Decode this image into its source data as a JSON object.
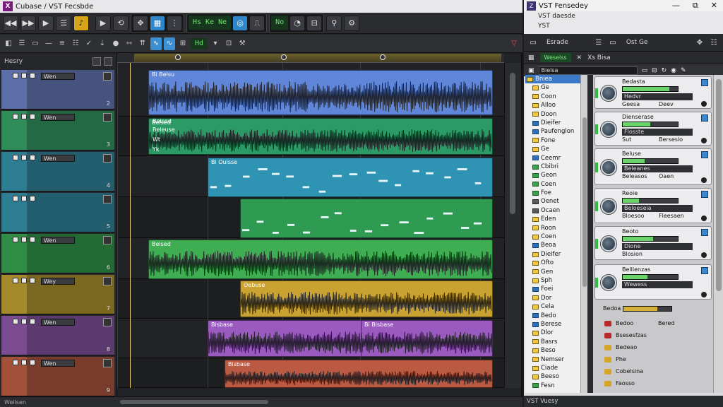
{
  "daw": {
    "title": "Cubase / VST Fecsbde",
    "logo": "X",
    "lcd_left": "Hs Ke Ne",
    "lcd_right": "No",
    "inspector_title": "Hesry",
    "status": "Weilsen",
    "tracks": [
      {
        "name": "Wen",
        "color": "#5c6fa8",
        "index": "2"
      },
      {
        "name": "Wen",
        "color": "#2f8d5a",
        "index": "3"
      },
      {
        "name": "Wen",
        "color": "#2d7d93",
        "index": "4"
      },
      {
        "name": "",
        "color": "#2d7d93",
        "index": "5"
      },
      {
        "name": "Wen",
        "color": "#2f8d45",
        "index": "6"
      },
      {
        "name": "Wey",
        "color": "#a48a2a",
        "index": "7"
      },
      {
        "name": "Wen",
        "color": "#7b4c92",
        "index": "8"
      },
      {
        "name": "Wen",
        "color": "#a3503a",
        "index": "9"
      }
    ],
    "clips": [
      {
        "name": "Bi Belsu",
        "color": "#5f86d8"
      },
      {
        "name": "Belsed",
        "color": "#2b9a64"
      },
      {
        "name": "Bi Ouisse",
        "color": "#2f93b3"
      },
      {
        "name": "",
        "color": "#2f9a52"
      },
      {
        "name": "Belsed",
        "color": "#3fae52"
      },
      {
        "name": "Oebuse",
        "color": "#c9a231"
      },
      {
        "name": "Bisbase",
        "color": "#9a5ac0"
      },
      {
        "name": "Bi Bisbase",
        "color": "#9a5ac0"
      },
      {
        "name": "Bisbase",
        "color": "#bb5a42"
      }
    ],
    "sub_labels": [
      "Belsed",
      "Beleuse",
      "Wt",
      "Yk"
    ]
  },
  "vst": {
    "title": "VST Fensedey",
    "logo": "Z",
    "sub1": "VST daesde",
    "sub2": "YST",
    "tab1": "Esrade",
    "tab2": "Ost Ge",
    "chip1": "Weselss",
    "chip2": "Xs Bisa",
    "search_label": "Bielsa",
    "status": "VST Vuesy",
    "tree": [
      {
        "label": "Bniea",
        "type": "sel"
      },
      {
        "label": "Ge",
        "type": "yellow"
      },
      {
        "label": "Coon",
        "type": "yellow"
      },
      {
        "label": "Alloo",
        "type": "yellow"
      },
      {
        "label": "Doon",
        "type": "yellow"
      },
      {
        "label": "Dieifer",
        "type": "blue"
      },
      {
        "label": "Paufenglon",
        "type": "blue"
      },
      {
        "label": "Fone",
        "type": "yellow"
      },
      {
        "label": "Ge",
        "type": "yellow"
      },
      {
        "label": "Ceemr",
        "type": "blue"
      },
      {
        "label": "Cbibri",
        "type": "green"
      },
      {
        "label": "Geon",
        "type": "green"
      },
      {
        "label": "Coen",
        "type": "green"
      },
      {
        "label": "Foe",
        "type": "green"
      },
      {
        "label": "Oenet",
        "type": "dark"
      },
      {
        "label": "Ocaen",
        "type": "dark"
      },
      {
        "label": "Eden",
        "type": "yellow"
      },
      {
        "label": "Roon",
        "type": "yellow"
      },
      {
        "label": "Coen",
        "type": "yellow"
      },
      {
        "label": "Beoa",
        "type": "blue"
      },
      {
        "label": "Dieifer",
        "type": "yellow"
      },
      {
        "label": "Ofto",
        "type": "yellow"
      },
      {
        "label": "Gen",
        "type": "yellow"
      },
      {
        "label": "Sph",
        "type": "yellow"
      },
      {
        "label": "Foei",
        "type": "blue"
      },
      {
        "label": "Dor",
        "type": "yellow"
      },
      {
        "label": "Cela",
        "type": "yellow"
      },
      {
        "label": "Bedo",
        "type": "blue"
      },
      {
        "label": "Berese",
        "type": "blue"
      },
      {
        "label": "Dlor",
        "type": "yellow"
      },
      {
        "label": "Basrs",
        "type": "yellow"
      },
      {
        "label": "Beso",
        "type": "yellow"
      },
      {
        "label": "Nemser",
        "type": "yellow"
      },
      {
        "label": "Ciade",
        "type": "yellow"
      },
      {
        "label": "Beeso",
        "type": "yellow"
      },
      {
        "label": "Fesn",
        "type": "green"
      }
    ],
    "plugins": [
      {
        "title": "Bedasta",
        "l1": "Hedvr",
        "l2": "Geesa",
        "l3": "Deev",
        "fill": 0.85
      },
      {
        "title": "Dienserase",
        "l1": "Flosste",
        "l2": "Sut",
        "l3": "Berseslo",
        "fill": 0.5
      },
      {
        "title": "Beluse",
        "l1": "Beleanes",
        "l2": "Beleasos",
        "l3": "Oaen",
        "fill": 0.4
      },
      {
        "title": "Reoie",
        "l1": "Beloeseia",
        "l2": "Bloesoo",
        "l3": "Fleesaen",
        "fill": 0.3
      },
      {
        "title": "Beoto",
        "l1": "Dione",
        "l2": "Blosion",
        "l3": "",
        "fill": 0.55
      },
      {
        "title": "Bellienzas",
        "l1": "Wewess",
        "l2": "",
        "l3": "",
        "fill": 0.45
      }
    ],
    "bottom_items": [
      {
        "label": "Bedoo",
        "extra": "Bered",
        "color": "#b82a2a"
      },
      {
        "label": "Bsesesfzas",
        "extra": "",
        "color": "#b82a2a"
      },
      {
        "label": "Bedeao",
        "extra": "",
        "color": "#d7a42a"
      },
      {
        "label": "Phe",
        "extra": "",
        "color": "#d7a42a"
      },
      {
        "label": "Cobelsina",
        "extra": "",
        "color": "#d7a42a"
      },
      {
        "label": "Faosso",
        "extra": "",
        "color": "#d7a42a"
      }
    ],
    "bottom_top_label": "Bedoa",
    "bottom_fill": 0.7
  }
}
